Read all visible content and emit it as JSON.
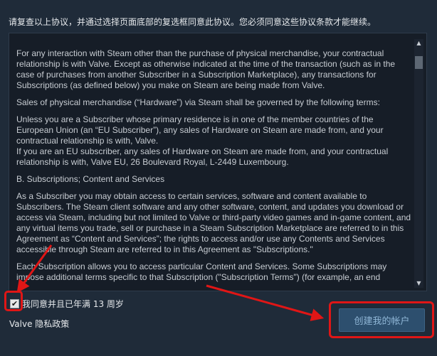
{
  "instructions": "请复查以上协议，并通过选择页面底部的复选框同意此协议。您必须同意这些协议条款才能继续。",
  "agreement": {
    "paragraphs": [
      "For any interaction with Steam other than the purchase of physical merchandise, your contractual relationship is with Valve. Except as otherwise indicated at the time of the transaction (such as in the case of purchases from another Subscriber in a Subscription Marketplace), any transactions for Subscriptions (as defined below) you make on Steam are being made from Valve.",
      "Sales of physical merchandise (“Hardware”) via Steam shall be governed by the following terms:",
      "Unless you are a Subscriber whose primary residence is in one of the member countries of the European Union (an “EU Subscriber”), any sales of Hardware on Steam are made from, and your contractual relationship is with, Valve.",
      "If you are an EU subscriber, any sales of Hardware on Steam are made from, and your contractual relationship is with, Valve EU, 26 Boulevard Royal, L-2449 Luxembourg.",
      "B. Subscriptions; Content and Services",
      "As a Subscriber you may obtain access to certain services, software and content available to Subscribers. The Steam client software and any other software, content, and updates you download or access via Steam, including but not limited to Valve or third-party video games and in-game content, and any virtual items you trade, sell or purchase in a Steam Subscription Marketplace are referred to in this Agreement as “Content and Services”; the rights to access and/or use any Contents and Services accessible through Steam are referred to in this Agreement as \"Subscriptions.\"",
      "Each Subscription allows you to access particular Content and Services. Some Subscriptions may impose additional terms specific to that Subscription (\"Subscription Terms\") (for example, an end"
    ]
  },
  "agree": {
    "checked": true,
    "check_glyph": "✔",
    "label": "我同意并且已年满 13 周岁"
  },
  "privacy_link": "Valve 隐私政策",
  "create_button": "创建我的帐户",
  "colors": {
    "background": "#1f2b39",
    "annotation": "#e01616",
    "button": "#2d4f6e"
  }
}
